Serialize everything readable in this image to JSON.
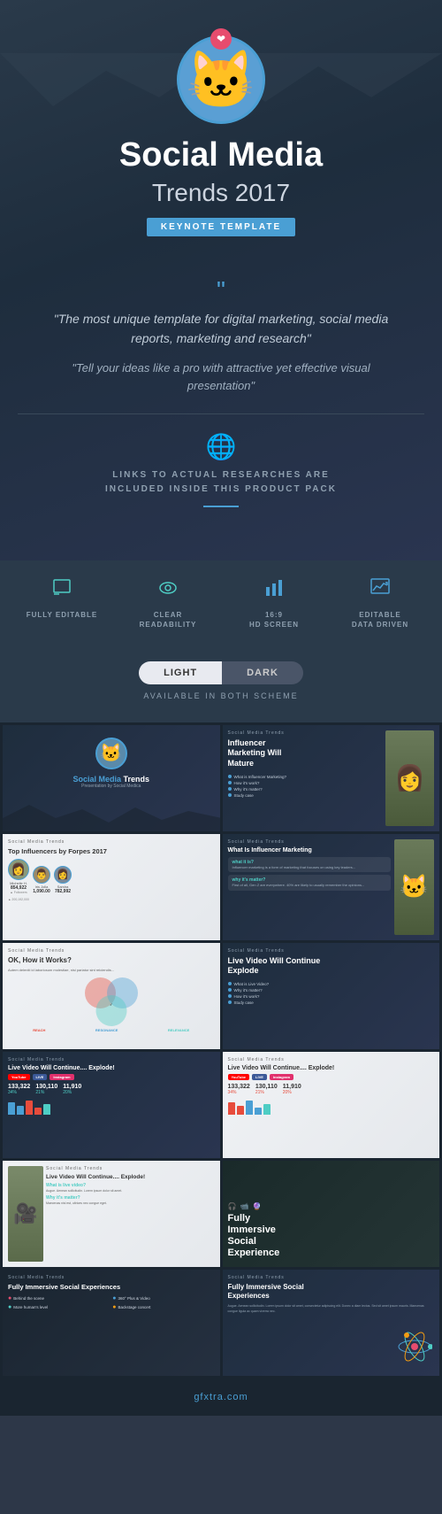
{
  "hero": {
    "title": "Social Media",
    "subtitle": "Trends 2017",
    "badge": "KEYNOTE TEMPLATE",
    "quote1": "\"The most unique template for digital marketing, social media reports, marketing and research\"",
    "quote2": "\"Tell your ideas like a pro with attractive yet effective visual presentation\"",
    "globe_text": "LINKS TO ACTUAL RESEARCHES ARE\nINCLUDED INSIDE THIS PRODUCT PACK"
  },
  "features": [
    {
      "icon": "✏️",
      "label": "FULLY\nEDITABLE",
      "color": "teal"
    },
    {
      "icon": "👁",
      "label": "CLEAR\nREADABILITY",
      "color": "teal"
    },
    {
      "icon": "📊",
      "label": "16:9\nHD SCREEN",
      "color": "blue"
    },
    {
      "icon": "📈",
      "label": "EDITABLE\nDATA DRIVEN",
      "color": "blue"
    }
  ],
  "scheme": {
    "light_label": "LIGHT",
    "dark_label": "DARK",
    "available_text": "AVAILABLE IN BOTH SCHEME"
  },
  "slides": {
    "s1_title": "Social Media",
    "s1_title2": "Trends",
    "s1_sub": "Presentation by Social Medica",
    "s2_title": "Influencer\nMarketing Will\nMature",
    "s2_checks": [
      "What is Influencer Marketing?",
      "How it's work?",
      "Why it's matter?",
      "Study case"
    ],
    "s3_title": "Top Influencers by Forpes 2017",
    "s3_people": [
      "Michelle H.",
      "Iris Jolla",
      "Samira Mustafa"
    ],
    "s3_stats": [
      "854,922",
      "1,090.00",
      "782,992"
    ],
    "s4_title": "What Is Influencer Marketing",
    "s4_what": "what it is?",
    "s4_why": "why it's matter?",
    "s5_title": "OK, How it Works?",
    "s5_labels": [
      "REACH",
      "RESONANCE",
      "RELEVANCE"
    ],
    "s6_title": "Live Video Will Continue\nExplode",
    "s6_checks": [
      "What is Live Video?",
      "Why it's matter?",
      "How it's work?",
      "Study case"
    ],
    "s7_title": "Live Video Will Continue.... Explode!",
    "s7_nums": [
      "133,322",
      "34%",
      "130,110",
      "21%",
      "11,910",
      "20%"
    ],
    "s8_title": "Live Video Will Continue.... Explode!",
    "s9_title": "Live Video Will Continue.... Explode!",
    "s9_what": "What is live video?",
    "s9_why": "Why it's matter?",
    "s10_title": "Fully\nImmersive\nSocial\nExperience",
    "s11_title": "Fully Immersive Social Experiences",
    "s11_items": [
      "Behind the scene",
      "360° Plus & Video",
      "More human's level",
      "Backstage concert"
    ],
    "s12_title": "Fully Immersive Social\nExperiences",
    "watermark": "gfxtra.com"
  }
}
